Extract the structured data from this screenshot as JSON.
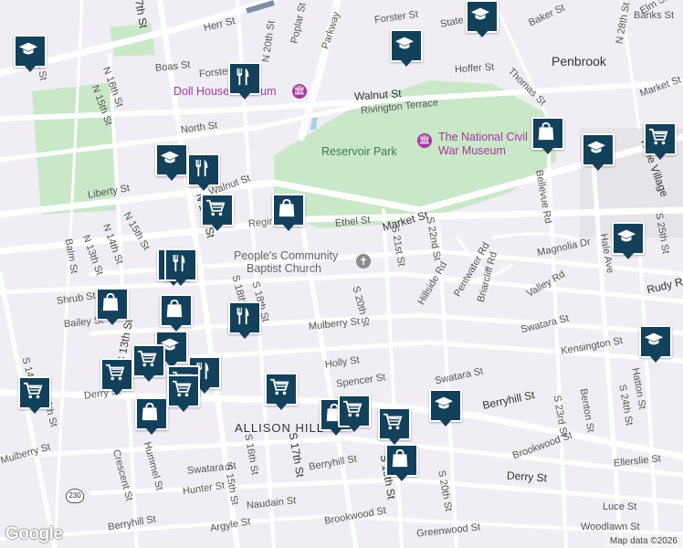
{
  "map": {
    "colors": {
      "background": "#f0eef4",
      "park": "#c9e8c8",
      "road": "#ffffff",
      "water": "#a8cfe6",
      "marker": "#13405a",
      "poi_text": "#a5389e"
    },
    "streets": [
      "Herr St",
      "Poplar St",
      "N 20th St",
      "Forster St",
      "Parkway",
      "State St",
      "Baker St",
      "Banks St",
      "N 28th St",
      "Boas St",
      "Hoffer St",
      "Forster St",
      "Penbrook",
      "Thomas St",
      "Market St",
      "Walnut St",
      "Rivington Terrace",
      "N 16th St",
      "N 15th St",
      "North St",
      "Liberty St",
      "Walnut St",
      "Regina St",
      "Ethel St",
      "Market St",
      "S 21st St",
      "S 22nd St",
      "N 15th St",
      "N 14th St",
      "N 13th St",
      "Balm St",
      "Shrub St",
      "Bailey St",
      "S 18th St",
      "S 20th St",
      "Hillside Rd",
      "Pentwater Rd",
      "Briarcliff Rd",
      "Bellevue Rd",
      "Magnolia Dr",
      "Valley Rd",
      "Hale Ave",
      "S 25th St",
      "Rudy Rd",
      "Kline Village",
      "Mulberry St",
      "Swatara St",
      "Kensington St",
      "Holly St",
      "Spencer St",
      "Swatara St",
      "Berryhill St",
      "Hatton St",
      "S 24th St",
      "Benton St",
      "S 23rd St",
      "Derry St",
      "Brookwood St",
      "Ellerslie St",
      "S 19th St",
      "S 20th St",
      "Swatara St",
      "Hunter St",
      "S 16th St",
      "S 15th St",
      "S 17th St",
      "Berryhill St",
      "Naudain St",
      "Brookwood St",
      "Greenwood St",
      "Luce St",
      "Woodlawn St",
      "Argyle St",
      "Berryhill St",
      "Hummel St",
      "Crescent St",
      "Mulberry St",
      "Derry St",
      "N 14th St",
      "N 17th St",
      "N 19th St",
      "Elm St",
      "S 13th St",
      "S 14th St",
      "S 12th St",
      "S 18th St"
    ],
    "poi_labels": {
      "doll_house": "Doll House Museum",
      "war_museum": "The National Civil War Museum",
      "reservoir": "Reservoir Park",
      "church_line1": "People's Community",
      "church_line2": "Baptist Church",
      "allison_hill": "ALLISON HILL",
      "route": "230"
    },
    "attribution": "Map data ©2026",
    "logo": "Google",
    "markers": [
      {
        "type": "education",
        "icon": "graduation-cap-icon"
      },
      {
        "type": "education",
        "icon": "graduation-cap-icon"
      },
      {
        "type": "education",
        "icon": "graduation-cap-icon"
      },
      {
        "type": "education",
        "icon": "graduation-cap-icon"
      },
      {
        "type": "education",
        "icon": "graduation-cap-icon"
      },
      {
        "type": "education",
        "icon": "graduation-cap-icon"
      },
      {
        "type": "education",
        "icon": "graduation-cap-icon"
      },
      {
        "type": "education",
        "icon": "graduation-cap-icon"
      },
      {
        "type": "education",
        "icon": "graduation-cap-icon"
      },
      {
        "type": "restaurant",
        "icon": "fork-knife-icon"
      },
      {
        "type": "restaurant",
        "icon": "fork-knife-icon"
      },
      {
        "type": "restaurant",
        "icon": "fork-knife-icon"
      },
      {
        "type": "restaurant",
        "icon": "fork-knife-icon"
      },
      {
        "type": "restaurant",
        "icon": "fork-knife-icon"
      },
      {
        "type": "restaurant",
        "icon": "fork-knife-icon"
      },
      {
        "type": "shopping",
        "icon": "shopping-bag-icon"
      },
      {
        "type": "shopping",
        "icon": "shopping-bag-icon"
      },
      {
        "type": "shopping",
        "icon": "shopping-bag-icon"
      },
      {
        "type": "shopping",
        "icon": "shopping-bag-icon"
      },
      {
        "type": "shopping",
        "icon": "shopping-bag-icon"
      },
      {
        "type": "shopping",
        "icon": "shopping-bag-icon"
      },
      {
        "type": "shopping",
        "icon": "shopping-bag-icon"
      },
      {
        "type": "grocery",
        "icon": "shopping-cart-icon"
      },
      {
        "type": "grocery",
        "icon": "shopping-cart-icon"
      },
      {
        "type": "grocery",
        "icon": "shopping-cart-icon"
      },
      {
        "type": "grocery",
        "icon": "shopping-cart-icon"
      },
      {
        "type": "grocery",
        "icon": "shopping-cart-icon"
      },
      {
        "type": "grocery",
        "icon": "shopping-cart-icon"
      },
      {
        "type": "grocery",
        "icon": "shopping-cart-icon"
      },
      {
        "type": "grocery",
        "icon": "shopping-cart-icon"
      },
      {
        "type": "grocery",
        "icon": "shopping-cart-icon"
      },
      {
        "type": "grocery",
        "icon": "shopping-cart-icon"
      }
    ]
  }
}
